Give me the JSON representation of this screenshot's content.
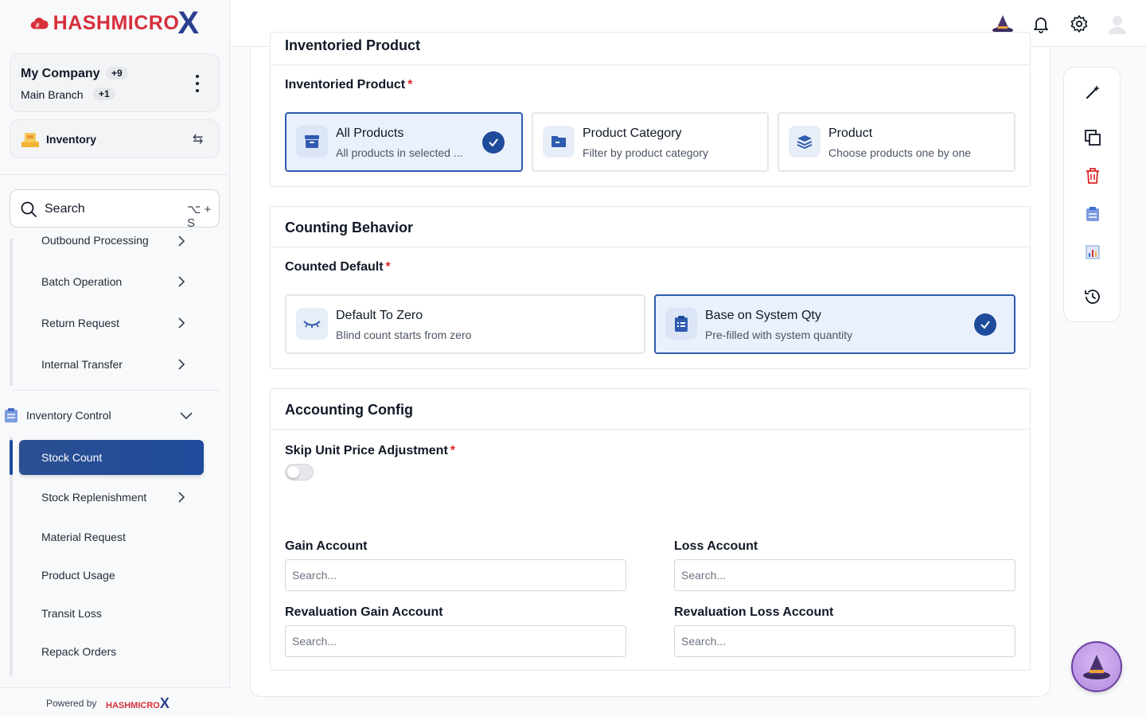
{
  "brand": {
    "name": "HASHMICRO",
    "x": "X"
  },
  "company": {
    "name": "My Company",
    "count_badge": "+9",
    "branch": "Main Branch",
    "branch_badge": "+1"
  },
  "module": {
    "label": "Inventory"
  },
  "search": {
    "label": "Search",
    "shortcut": "⌥ + S"
  },
  "nav": {
    "items_top": [
      {
        "label": "Outbound Processing"
      },
      {
        "label": "Batch Operation"
      },
      {
        "label": "Return Request"
      },
      {
        "label": "Internal Transfer"
      }
    ],
    "group": {
      "label": "Inventory Control"
    },
    "active": {
      "label": "Stock Count"
    },
    "items_bottom": [
      {
        "label": "Stock Replenishment"
      },
      {
        "label": "Material Request"
      },
      {
        "label": "Product Usage"
      },
      {
        "label": "Transit Loss"
      },
      {
        "label": "Repack Orders"
      }
    ]
  },
  "footer": {
    "powered_by": "Powered by",
    "logo_text": "HASHMICRO",
    "logo_x": "X"
  },
  "sections": {
    "inventoried": {
      "title": "Inventoried Product",
      "field_label": "Inventoried Product",
      "required": "*",
      "options": [
        {
          "title": "All Products",
          "subtitle": "All products in selected ..."
        },
        {
          "title": "Product Category",
          "subtitle": "Filter by product category"
        },
        {
          "title": "Product",
          "subtitle": "Choose products one by one"
        }
      ]
    },
    "counting": {
      "title": "Counting Behavior",
      "field_label": "Counted Default",
      "required": "*",
      "options": [
        {
          "title": "Default To Zero",
          "subtitle": "Blind count starts from zero"
        },
        {
          "title": "Base on System Qty",
          "subtitle": "Pre-filled with system quantity"
        }
      ]
    },
    "accounting": {
      "title": "Accounting Config",
      "skip_label": "Skip Unit Price Adjustment",
      "required": "*",
      "skip_enabled": false,
      "gain_label": "Gain Account",
      "loss_label": "Loss Account",
      "reval_gain_label": "Revaluation Gain Account",
      "reval_loss_label": "Revaluation Loss Account",
      "placeholder": "Search..."
    }
  },
  "colors": {
    "primary": "#1e4b9b",
    "brand_red": "#d62f3a",
    "required": "#dc2626"
  }
}
